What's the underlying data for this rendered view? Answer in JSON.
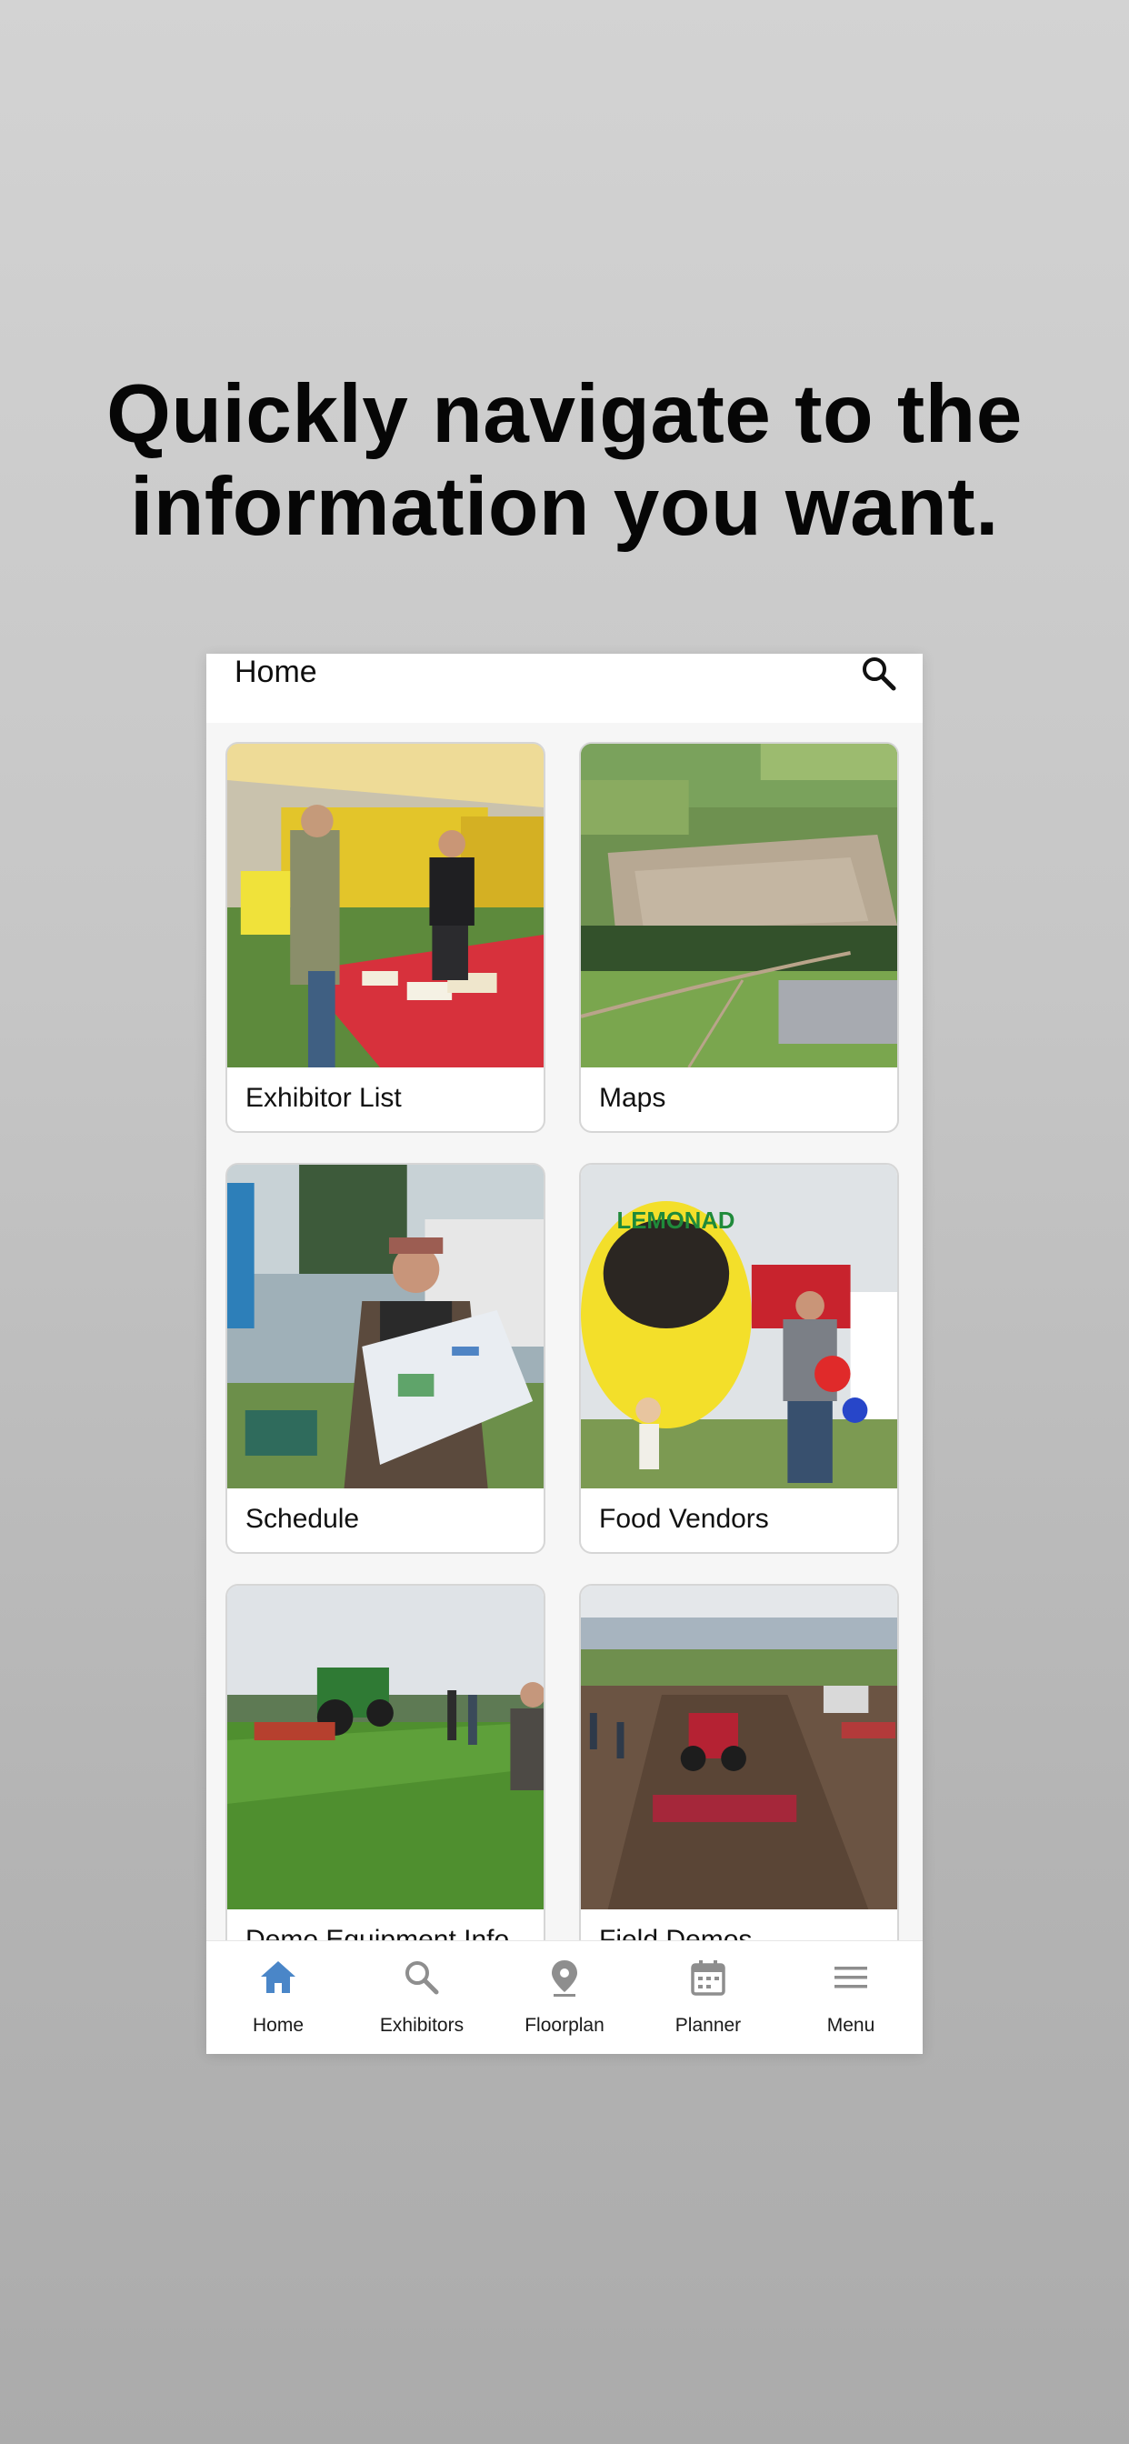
{
  "headline": {
    "line1": "Quickly navigate to the",
    "line2": "information you want."
  },
  "app": {
    "title": "Home",
    "search_icon": "search-icon",
    "accent_color": "#4a86c8",
    "inactive_icon_color": "#8e8e8e"
  },
  "cards": [
    {
      "label": "Exhibitor List",
      "photo": "exhibitor-booth-photo"
    },
    {
      "label": "Maps",
      "photo": "aerial-showground-photo"
    },
    {
      "label": "Schedule",
      "photo": "man-reading-map-photo"
    },
    {
      "label": "Food Vendors",
      "photo": "lemonade-stand-photo"
    },
    {
      "label": "Demo Equipment Info",
      "photo": "tractor-field-photo"
    },
    {
      "label": "Field Demos",
      "photo": "field-demo-crowd-photo"
    }
  ],
  "tabs": [
    {
      "label": "Home",
      "icon": "home-icon",
      "active": true
    },
    {
      "label": "Exhibitors",
      "icon": "search-icon",
      "active": false
    },
    {
      "label": "Floorplan",
      "icon": "map-pin-icon",
      "active": false
    },
    {
      "label": "Planner",
      "icon": "calendar-icon",
      "active": false
    },
    {
      "label": "Menu",
      "icon": "menu-icon",
      "active": false
    }
  ]
}
